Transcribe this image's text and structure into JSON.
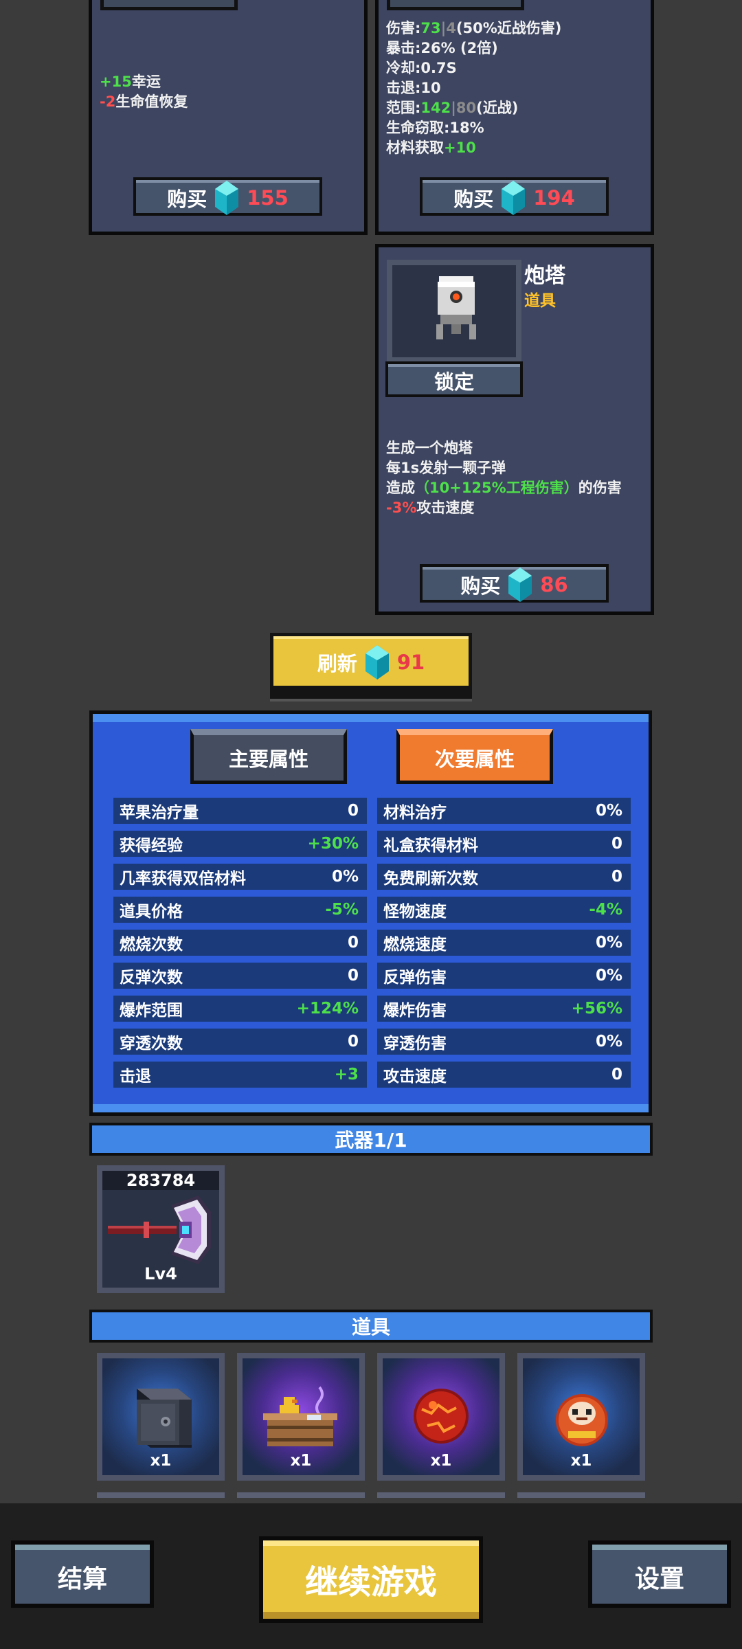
{
  "shop": {
    "card_left": {
      "stats": [
        {
          "delta": "+15",
          "name": "幸运"
        },
        {
          "delta": "-2",
          "name": "生命值恢复"
        }
      ],
      "buy_label": "购买",
      "price": "155"
    },
    "card_right": {
      "line1": {
        "k": "伤害:",
        "a": "73",
        "sep": "|",
        "b": "4",
        "c": "(50%近战伤害)"
      },
      "line2": "暴击:26% (2倍)",
      "line3": "冷却:0.7S",
      "line4": "击退:10",
      "line5": {
        "k": "范围:",
        "a": "142",
        "sep": "|",
        "b": "80",
        "c": "(近战)"
      },
      "line6": "生命窃取:18%",
      "line7": {
        "k": "材料获取",
        "a": "+10"
      },
      "buy_label": "购买",
      "price": "194"
    },
    "turret_card": {
      "name": "炮塔",
      "type": "道具",
      "lock_label": "锁定",
      "desc1": "生成一个炮塔",
      "desc2": "每1s发射一颗子弹",
      "desc3_pre": "造成",
      "desc3_hl": "（10+125%工程伤害）",
      "desc3_post": "的伤害",
      "desc4_delta": "-3%",
      "desc4_name": "攻击速度",
      "buy_label": "购买",
      "price": "86"
    }
  },
  "refresh": {
    "label": "刷新",
    "price": "91"
  },
  "stats_panel": {
    "tab_main": "主要属性",
    "tab_sub": "次要属性",
    "left": [
      {
        "name": "苹果治疗量",
        "value": "0"
      },
      {
        "name": "获得经验",
        "value": "+30%"
      },
      {
        "name": "几率获得双倍材料",
        "value": "0%"
      },
      {
        "name": "道具价格",
        "value": "-5%"
      },
      {
        "name": "燃烧次数",
        "value": "0"
      },
      {
        "name": "反弹次数",
        "value": "0"
      },
      {
        "name": "爆炸范围",
        "value": "+124%"
      },
      {
        "name": "穿透次数",
        "value": "0"
      },
      {
        "name": "击退",
        "value": "+3"
      }
    ],
    "right": [
      {
        "name": "材料治疗",
        "value": "0%"
      },
      {
        "name": "礼盒获得材料",
        "value": "0"
      },
      {
        "name": "免费刷新次数",
        "value": "0"
      },
      {
        "name": "怪物速度",
        "value": "-4%"
      },
      {
        "name": "燃烧速度",
        "value": "0%"
      },
      {
        "name": "反弹伤害",
        "value": "0%"
      },
      {
        "name": "爆炸伤害",
        "value": "+56%"
      },
      {
        "name": "穿透伤害",
        "value": "0%"
      },
      {
        "name": "攻击速度",
        "value": "0"
      }
    ]
  },
  "weapons": {
    "header": "武器1/1",
    "items": [
      {
        "score": "283784",
        "level": "Lv4",
        "icon": "axe-icon"
      }
    ]
  },
  "items": {
    "header": "道具",
    "list": [
      {
        "icon": "safe-icon",
        "qty": "x1"
      },
      {
        "icon": "bathtub-duck-icon",
        "qty": "x1"
      },
      {
        "icon": "lava-orb-icon",
        "qty": "x1"
      },
      {
        "icon": "daruma-icon",
        "qty": "x1"
      }
    ]
  },
  "bottom": {
    "settle": "结算",
    "continue": "继续游戏",
    "settings": "设置"
  },
  "colors": {
    "positive": "#4ee04a",
    "negative": "#ff4f4f",
    "price": "#ff4b55",
    "accent_yellow": "#e8c53c",
    "tab_active": "#f07a2e"
  }
}
